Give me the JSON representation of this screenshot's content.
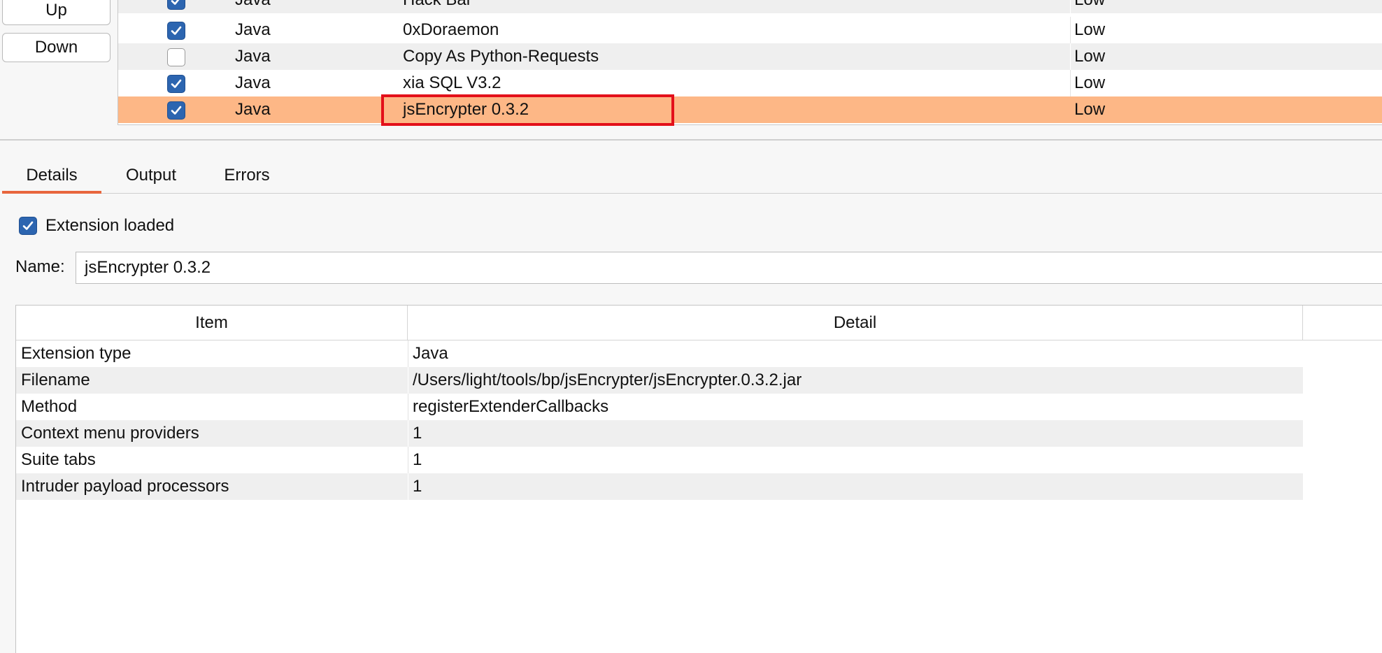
{
  "side_buttons": {
    "up_label": "Up",
    "down_label": "Down"
  },
  "extensions": {
    "rows": [
      {
        "loaded": true,
        "type": "Java",
        "name": "Hack Bar",
        "impact": "Low",
        "selected": false
      },
      {
        "loaded": true,
        "type": "Java",
        "name": "0xDoraemon",
        "impact": "Low",
        "selected": false
      },
      {
        "loaded": false,
        "type": "Java",
        "name": "Copy As Python-Requests",
        "impact": "Low",
        "selected": false
      },
      {
        "loaded": true,
        "type": "Java",
        "name": "xia SQL V3.2",
        "impact": "Low",
        "selected": false
      },
      {
        "loaded": true,
        "type": "Java",
        "name": "jsEncrypter 0.3.2",
        "impact": "Low",
        "selected": true
      }
    ],
    "highlight_color": "#e3101a",
    "selected_row_color": "#fdb786"
  },
  "tabs": {
    "details": "Details",
    "output": "Output",
    "errors": "Errors",
    "active": "Details",
    "active_color": "#e8663d"
  },
  "details": {
    "extension_loaded_label": "Extension loaded",
    "extension_loaded": true,
    "name_label": "Name:",
    "name_value": "jsEncrypter 0.3.2",
    "table": {
      "headers": {
        "item": "Item",
        "detail": "Detail"
      },
      "rows": [
        {
          "item": "Extension type",
          "detail": "Java"
        },
        {
          "item": "Filename",
          "detail": "/Users/light/tools/bp/jsEncrypter/jsEncrypter.0.3.2.jar"
        },
        {
          "item": "Method",
          "detail": "registerExtenderCallbacks"
        },
        {
          "item": "Context menu providers",
          "detail": "1"
        },
        {
          "item": "Suite tabs",
          "detail": "1"
        },
        {
          "item": "Intruder payload processors",
          "detail": "1"
        }
      ]
    }
  },
  "colors": {
    "checkbox_checked": "#2c65b0"
  }
}
